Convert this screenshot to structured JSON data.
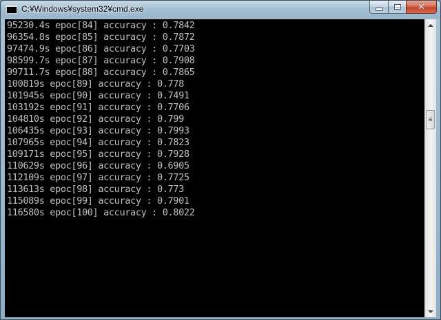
{
  "window": {
    "title": "C:¥Windows¥system32¥cmd.exe",
    "icon": "cmd-icon",
    "controls": {
      "minimize": "minimize-icon",
      "maximize": "maximize-icon",
      "close": "close-icon"
    }
  },
  "console": {
    "lines": [
      "95230.4s epoc[84] accuracy : 0.7842",
      "96354.8s epoc[85] accuracy : 0.7872",
      "97474.9s epoc[86] accuracy : 0.7703",
      "98599.7s epoc[87] accuracy : 0.7908",
      "99711.7s epoc[88] accuracy : 0.7865",
      "100819s epoc[89] accuracy : 0.778",
      "101945s epoc[90] accuracy : 0.7491",
      "103192s epoc[91] accuracy : 0.7706",
      "104810s epoc[92] accuracy : 0.799",
      "106435s epoc[93] accuracy : 0.7993",
      "107965s epoc[94] accuracy : 0.7823",
      "109171s epoc[95] accuracy : 0.7928",
      "110629s epoc[96] accuracy : 0.6905",
      "112109s epoc[97] accuracy : 0.7725",
      "113613s epoc[98] accuracy : 0.773",
      "115089s epoc[99] accuracy : 0.7901",
      "116580s epoc[100] accuracy : 0.8022"
    ]
  },
  "colors": {
    "console_bg": "#000000",
    "console_fg": "#c0c0c0",
    "close_button": "#c2432b"
  }
}
